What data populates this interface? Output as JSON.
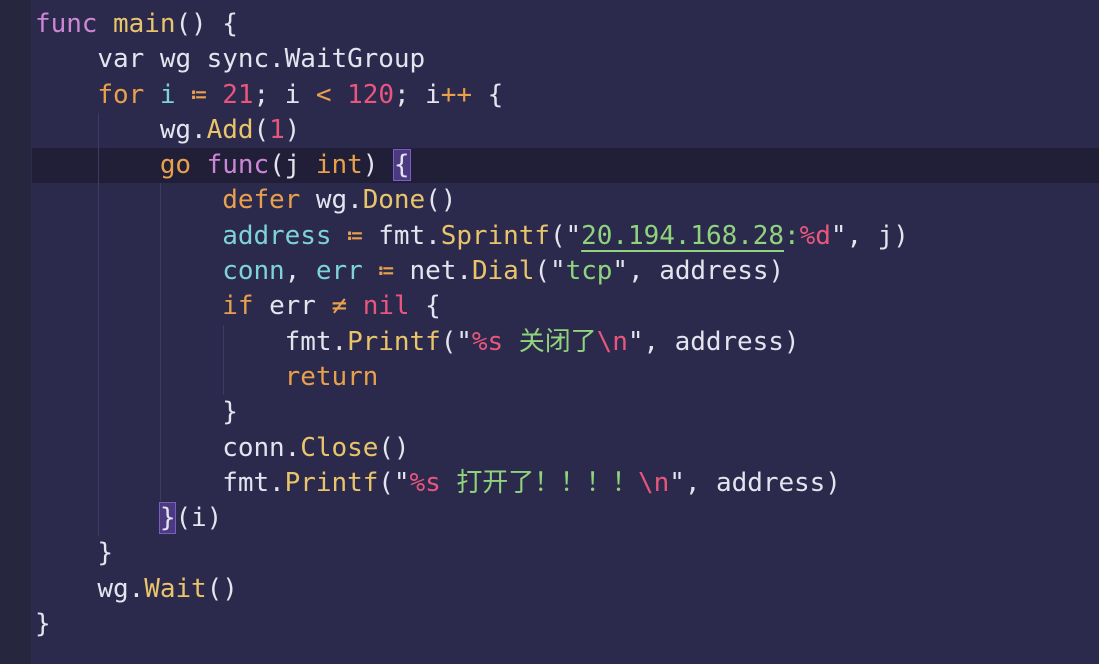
{
  "editor": {
    "current_line": 5,
    "colors": {
      "background": "#2b2a4c",
      "current_line": "#201f37",
      "keyword": "#e8a04c",
      "func": "#cd86d6",
      "function_name": "#e9c46a",
      "variable": "#7dd3d8",
      "number": "#e8567e",
      "string": "#8fd47c"
    },
    "lines": [
      {
        "indent": 0,
        "tokens": [
          [
            "func ",
            "f"
          ],
          [
            "main",
            "fn"
          ],
          [
            "() {",
            "p"
          ]
        ]
      },
      {
        "indent": 1,
        "tokens": [
          [
            "var wg sync.WaitGroup",
            "p"
          ]
        ]
      },
      {
        "indent": 1,
        "tokens": [
          [
            "for ",
            "k"
          ],
          [
            "i ",
            "v"
          ],
          [
            "≔ ",
            "k"
          ],
          [
            "21",
            "n"
          ],
          [
            "; i ",
            "p"
          ],
          [
            "< ",
            "k"
          ],
          [
            "120",
            "n"
          ],
          [
            "; i",
            "p"
          ],
          [
            "++",
            "k"
          ],
          [
            " {",
            "p"
          ]
        ]
      },
      {
        "indent": 2,
        "tokens": [
          [
            "wg.",
            "p"
          ],
          [
            "Add",
            "fn"
          ],
          [
            "(",
            "p"
          ],
          [
            "1",
            "n"
          ],
          [
            ")",
            "p"
          ]
        ]
      },
      {
        "indent": 2,
        "tokens": [
          [
            "go ",
            "k"
          ],
          [
            "func",
            "f"
          ],
          [
            "(j ",
            "p"
          ],
          [
            "int",
            "t"
          ],
          [
            ") ",
            "p"
          ],
          [
            "{",
            "br"
          ]
        ]
      },
      {
        "indent": 3,
        "tokens": [
          [
            "defer ",
            "k"
          ],
          [
            "wg.",
            "p"
          ],
          [
            "Done",
            "fn"
          ],
          [
            "()",
            "p"
          ]
        ]
      },
      {
        "indent": 3,
        "tokens": [
          [
            "address ",
            "v"
          ],
          [
            "≔ ",
            "k"
          ],
          [
            "fmt.",
            "p"
          ],
          [
            "Sprintf",
            "fn"
          ],
          [
            "(\"",
            "p"
          ],
          [
            "20.194.168.28",
            "su"
          ],
          [
            ":",
            "s"
          ],
          [
            "%d",
            "e"
          ],
          [
            "\", j)",
            "p"
          ]
        ]
      },
      {
        "indent": 3,
        "tokens": [
          [
            "conn",
            "v"
          ],
          [
            ", ",
            "p"
          ],
          [
            "err ",
            "v"
          ],
          [
            "≔ ",
            "k"
          ],
          [
            "net.",
            "p"
          ],
          [
            "Dial",
            "fn"
          ],
          [
            "(\"",
            "p"
          ],
          [
            "tcp",
            "s"
          ],
          [
            "\", address)",
            "p"
          ]
        ]
      },
      {
        "indent": 3,
        "tokens": [
          [
            "if ",
            "k"
          ],
          [
            "err ",
            "p"
          ],
          [
            "≠ ",
            "k"
          ],
          [
            "nil",
            "n"
          ],
          [
            " {",
            "p"
          ]
        ]
      },
      {
        "indent": 4,
        "tokens": [
          [
            "fmt.",
            "p"
          ],
          [
            "Printf",
            "fn"
          ],
          [
            "(\"",
            "p"
          ],
          [
            "%s",
            "e"
          ],
          [
            " 关闭了",
            "s"
          ],
          [
            "\\n",
            "e"
          ],
          [
            "\", address)",
            "p"
          ]
        ]
      },
      {
        "indent": 4,
        "tokens": [
          [
            "return",
            "k"
          ]
        ]
      },
      {
        "indent": 3,
        "tokens": [
          [
            "}",
            "p"
          ]
        ]
      },
      {
        "indent": 3,
        "tokens": [
          [
            "conn.",
            "p"
          ],
          [
            "Close",
            "fn"
          ],
          [
            "()",
            "p"
          ]
        ]
      },
      {
        "indent": 3,
        "tokens": [
          [
            "fmt.",
            "p"
          ],
          [
            "Printf",
            "fn"
          ],
          [
            "(\"",
            "p"
          ],
          [
            "%s",
            "e"
          ],
          [
            " 打开了！！！！",
            "s"
          ],
          [
            "\\n",
            "e"
          ],
          [
            "\", address)",
            "p"
          ]
        ]
      },
      {
        "indent": 2,
        "tokens": [
          [
            "}",
            "br"
          ],
          [
            "(i)",
            "p"
          ]
        ]
      },
      {
        "indent": 1,
        "tokens": [
          [
            "}",
            "p"
          ]
        ]
      },
      {
        "indent": 1,
        "tokens": [
          [
            "wg.",
            "p"
          ],
          [
            "Wait",
            "fn"
          ],
          [
            "()",
            "p"
          ]
        ]
      },
      {
        "indent": 0,
        "tokens": [
          [
            "}",
            "p"
          ]
        ]
      }
    ]
  }
}
